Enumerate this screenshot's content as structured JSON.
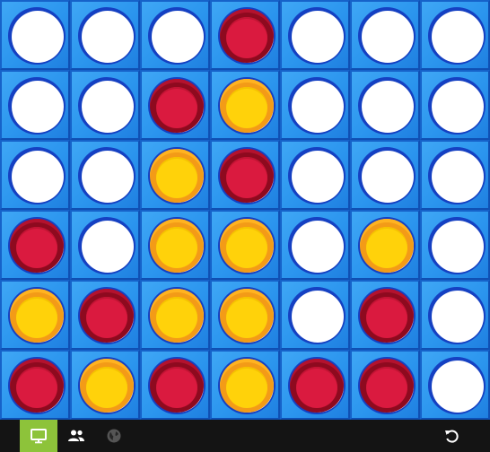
{
  "game": {
    "name": "connect-four",
    "columns": 7,
    "rows": 6,
    "board": [
      [
        "empty",
        "empty",
        "empty",
        "red",
        "empty",
        "empty",
        "empty"
      ],
      [
        "empty",
        "empty",
        "red",
        "yellow",
        "empty",
        "empty",
        "empty"
      ],
      [
        "empty",
        "empty",
        "yellow",
        "red",
        "empty",
        "empty",
        "empty"
      ],
      [
        "red",
        "empty",
        "yellow",
        "yellow",
        "empty",
        "yellow",
        "empty"
      ],
      [
        "yellow",
        "red",
        "yellow",
        "yellow",
        "empty",
        "red",
        "empty"
      ],
      [
        "red",
        "yellow",
        "red",
        "yellow",
        "red",
        "red",
        "empty"
      ]
    ]
  },
  "colors": {
    "board_blue": "#2b95ee",
    "hole_rim": "#1540c2",
    "red_disc": "#da1a3f",
    "yellow_disc": "#ffd20a",
    "toolbar_bg": "#141414",
    "active_tab": "#8dc33a"
  },
  "toolbar": {
    "buttons": [
      {
        "icon": "monitor-icon",
        "active": true
      },
      {
        "icon": "people-icon",
        "active": false
      },
      {
        "icon": "globe-icon",
        "active": false
      },
      {
        "icon": "restart-icon",
        "active": false
      }
    ]
  }
}
